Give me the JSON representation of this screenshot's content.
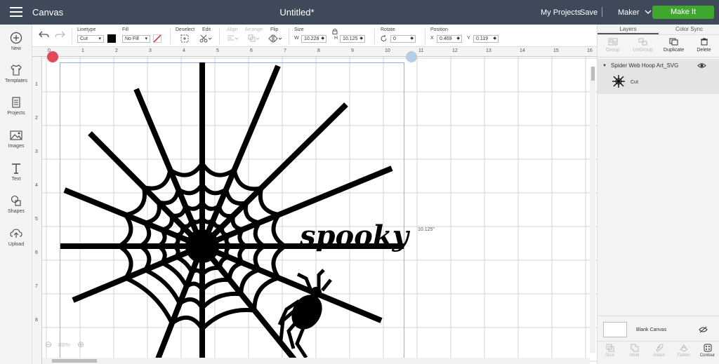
{
  "header": {
    "app_title": "Canvas",
    "doc_title": "Untitled*",
    "my_projects": "My Projects",
    "save": "Save",
    "separator": "|",
    "machine": "Maker",
    "make_it": "Make It",
    "colors": {
      "bar": "#3e4a59",
      "make_it": "#3fa630"
    }
  },
  "sidenav": {
    "items": [
      {
        "label": "New",
        "icon": "plus-circle-icon"
      },
      {
        "label": "Templates",
        "icon": "shirt-icon"
      },
      {
        "label": "Projects",
        "icon": "projects-icon"
      },
      {
        "label": "Images",
        "icon": "image-icon"
      },
      {
        "label": "Text",
        "icon": "text-t-icon"
      },
      {
        "label": "Shapes",
        "icon": "shapes-icon"
      },
      {
        "label": "Upload",
        "icon": "upload-icon"
      }
    ]
  },
  "toolbar": {
    "linetype_label": "Linetype",
    "linetype_value": "Cut",
    "fill_label": "Fill",
    "fill_value": "No Fill",
    "deselect_label": "Deselect",
    "edit_label": "Edit",
    "align_label": "Align",
    "arrange_label": "Arrange",
    "flip_label": "Flip",
    "size_label": "Size",
    "w_label": "W",
    "w_value": "10.228",
    "h_label": "H",
    "h_value": "10.125",
    "rotate_label": "Rotate",
    "rotate_value": "0",
    "position_label": "Position",
    "x_label": "X",
    "x_value": "0.469",
    "y_label": "Y",
    "y_value": "0.119",
    "linetype_color": "#000000",
    "fill_slash_color": "#d9252b"
  },
  "canvas": {
    "ruler_top": [
      "0",
      "1",
      "2",
      "3",
      "4",
      "5",
      "6",
      "7",
      "8",
      "9",
      "10",
      "11",
      "12",
      "13",
      "14",
      "15",
      "16"
    ],
    "ruler_left": [
      "1",
      "2",
      "3",
      "4",
      "5",
      "6",
      "7",
      "8"
    ],
    "dimension_label": "10.125\"",
    "spooky_text": "spooky",
    "zoom_minus": "⊖",
    "zoom_value": "100%",
    "zoom_plus": "⊕"
  },
  "panel": {
    "tabs": [
      "Layers",
      "Color Sync"
    ],
    "tools": [
      "Group",
      "UnGroup",
      "Duplicate",
      "Delete"
    ],
    "layer_name": "Spider Web Hoop Art_SVG",
    "layer_operation": "Cut",
    "blank_canvas": "Blank Canvas",
    "bottom_tools": [
      "Slice",
      "Weld",
      "Attach",
      "Flatten",
      "Contour"
    ]
  }
}
